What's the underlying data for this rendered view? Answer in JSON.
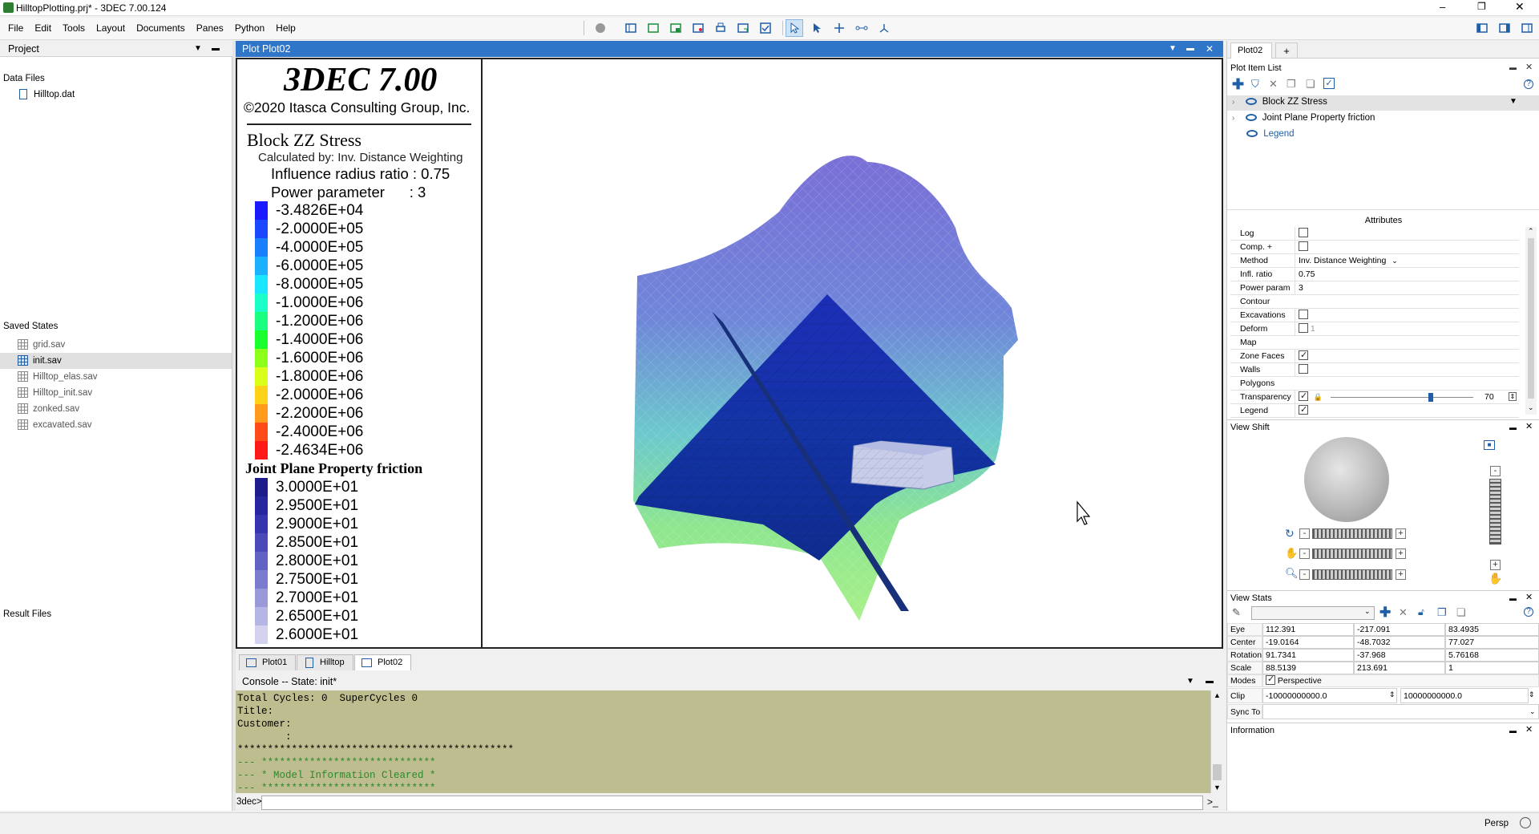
{
  "window": {
    "title": "HilltopPlotting.prj* - 3DEC 7.00.124"
  },
  "menu": [
    "File",
    "Edit",
    "Tools",
    "Layout",
    "Documents",
    "Panes",
    "Python",
    "Help"
  ],
  "project_pane": {
    "title": "Project",
    "data_files_label": "Data Files",
    "data_files": [
      "Hilltop.dat"
    ],
    "saved_states_label": "Saved States",
    "saved_states": [
      "grid.sav",
      "init.sav",
      "Hilltop_elas.sav",
      "Hilltop_init.sav",
      "zonked.sav",
      "excavated.sav"
    ],
    "selected_state": "init.sav",
    "result_files_label": "Result Files"
  },
  "plot_pane": {
    "title": "Plot Plot02"
  },
  "legend": {
    "app_title": "3DEC 7.00",
    "copyright": "©2020 Itasca Consulting Group, Inc.",
    "block_title": "Block ZZ Stress",
    "calc_by": "Calculated by: Inv. Distance Weighting",
    "infl_line": "Influence radius ratio : 0.75",
    "power_line": "Power parameter      : 3",
    "stress_values": [
      "-3.4826E+04",
      "-2.0000E+05",
      "-4.0000E+05",
      "-6.0000E+05",
      "-8.0000E+05",
      "-1.0000E+06",
      "-1.2000E+06",
      "-1.4000E+06",
      "-1.6000E+06",
      "-1.8000E+06",
      "-2.0000E+06",
      "-2.2000E+06",
      "-2.4000E+06",
      "-2.4634E+06"
    ],
    "stress_colors": [
      "#1a1aff",
      "#1a47ff",
      "#1a7fff",
      "#1ab2ff",
      "#1ae6ff",
      "#1affc8",
      "#1aff80",
      "#1aff2e",
      "#8cff1a",
      "#d9ff1a",
      "#ffd21a",
      "#ff9a1a",
      "#ff4a1a",
      "#ff1a1a"
    ],
    "joint_title": "Joint Plane Property friction",
    "joint_values": [
      "3.0000E+01",
      "2.9500E+01",
      "2.9000E+01",
      "2.8500E+01",
      "2.8000E+01",
      "2.7500E+01",
      "2.7000E+01",
      "2.6500E+01",
      "2.6000E+01"
    ],
    "joint_colors": [
      "#1c1c8c",
      "#26269e",
      "#3535ad",
      "#4a4ab8",
      "#6262c4",
      "#7c7ccf",
      "#9999da",
      "#b6b6e6",
      "#d3d3f0"
    ]
  },
  "bottom_tabs": [
    "Plot01",
    "Hilltop",
    "Plot02"
  ],
  "console": {
    "title": "Console -- State: init*",
    "lines": [
      "Total Cycles: 0  SuperCycles 0",
      "Title:",
      "Customer:",
      "        :",
      "**********************************************",
      "--- *****************************",
      "--- * Model Information Cleared *",
      "--- *****************************"
    ],
    "prompt": "3dec>",
    "input_value": ""
  },
  "right": {
    "tab": "Plot02",
    "add_tab": "+",
    "plot_item_list_title": "Plot Item List",
    "items": [
      "Block ZZ Stress",
      "Joint Plane Property friction",
      "Legend"
    ],
    "attributes_title": "Attributes",
    "attributes": {
      "log": "Log",
      "comp": "Comp. +",
      "method": "Method",
      "method_value": "Inv. Distance Weighting",
      "infl": "Infl. ratio",
      "infl_value": "0.75",
      "power": "Power param",
      "power_value": "3",
      "contour": "Contour",
      "excavations": "Excavations",
      "deform": "Deform",
      "deform_value": "1",
      "map": "Map",
      "zone_faces": "Zone Faces",
      "walls": "Walls",
      "polygons": "Polygons",
      "transparency": "Transparency",
      "transparency_value": "70",
      "legend": "Legend"
    },
    "view_shift_title": "View Shift",
    "view_stats_title": "View Stats",
    "stats": {
      "eye_label": "Eye",
      "eye": [
        "112.391",
        "-217.091",
        "83.4935"
      ],
      "center_label": "Center",
      "center": [
        "-19.0164",
        "-48.7032",
        "77.027"
      ],
      "rotation_label": "Rotation",
      "rotation": [
        "91.7341",
        "-37.968",
        "5.76168"
      ],
      "scale_label": "Scale",
      "scale": [
        "88.5139",
        "213.691",
        "1"
      ],
      "modes_label": "Modes",
      "perspective": "Perspective",
      "clip_label": "Clip",
      "clip": [
        "-10000000000.0",
        "10000000000.0"
      ],
      "sync_label": "Sync To"
    },
    "information_title": "Information"
  },
  "status": {
    "persp": "Persp"
  }
}
